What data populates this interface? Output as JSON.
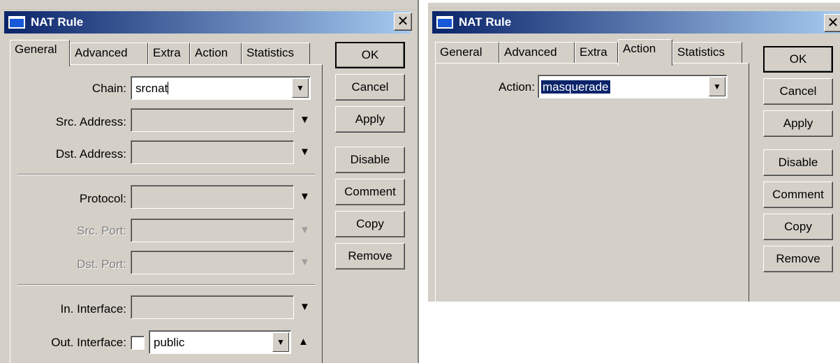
{
  "left_window": {
    "title": "NAT Rule",
    "tabs": [
      "General",
      "Advanced",
      "Extra",
      "Action",
      "Statistics"
    ],
    "active_tab": "General",
    "fields": {
      "chain_label": "Chain:",
      "chain_value": "srcnat",
      "src_address_label": "Src. Address:",
      "dst_address_label": "Dst. Address:",
      "protocol_label": "Protocol:",
      "src_port_label": "Src. Port:",
      "dst_port_label": "Dst. Port:",
      "in_interface_label": "In. Interface:",
      "out_interface_label": "Out. Interface:",
      "out_interface_value": "public"
    },
    "buttons": [
      "OK",
      "Cancel",
      "Apply",
      "Disable",
      "Comment",
      "Copy",
      "Remove"
    ]
  },
  "right_window": {
    "title": "NAT Rule",
    "tabs": [
      "General",
      "Advanced",
      "Extra",
      "Action",
      "Statistics"
    ],
    "active_tab": "Action",
    "fields": {
      "action_label": "Action:",
      "action_value": "masquerade"
    },
    "buttons": [
      "OK",
      "Cancel",
      "Apply",
      "Disable",
      "Comment",
      "Copy",
      "Remove"
    ]
  },
  "icons": {
    "close": "close-icon",
    "dropdown": "dropdown-arrow-icon",
    "expand": "expand-down-icon",
    "collapse": "collapse-up-icon"
  },
  "colors": {
    "titlebar_start": "#0a246a",
    "titlebar_end": "#a6caf0",
    "window_bg": "#d4d0c8"
  }
}
